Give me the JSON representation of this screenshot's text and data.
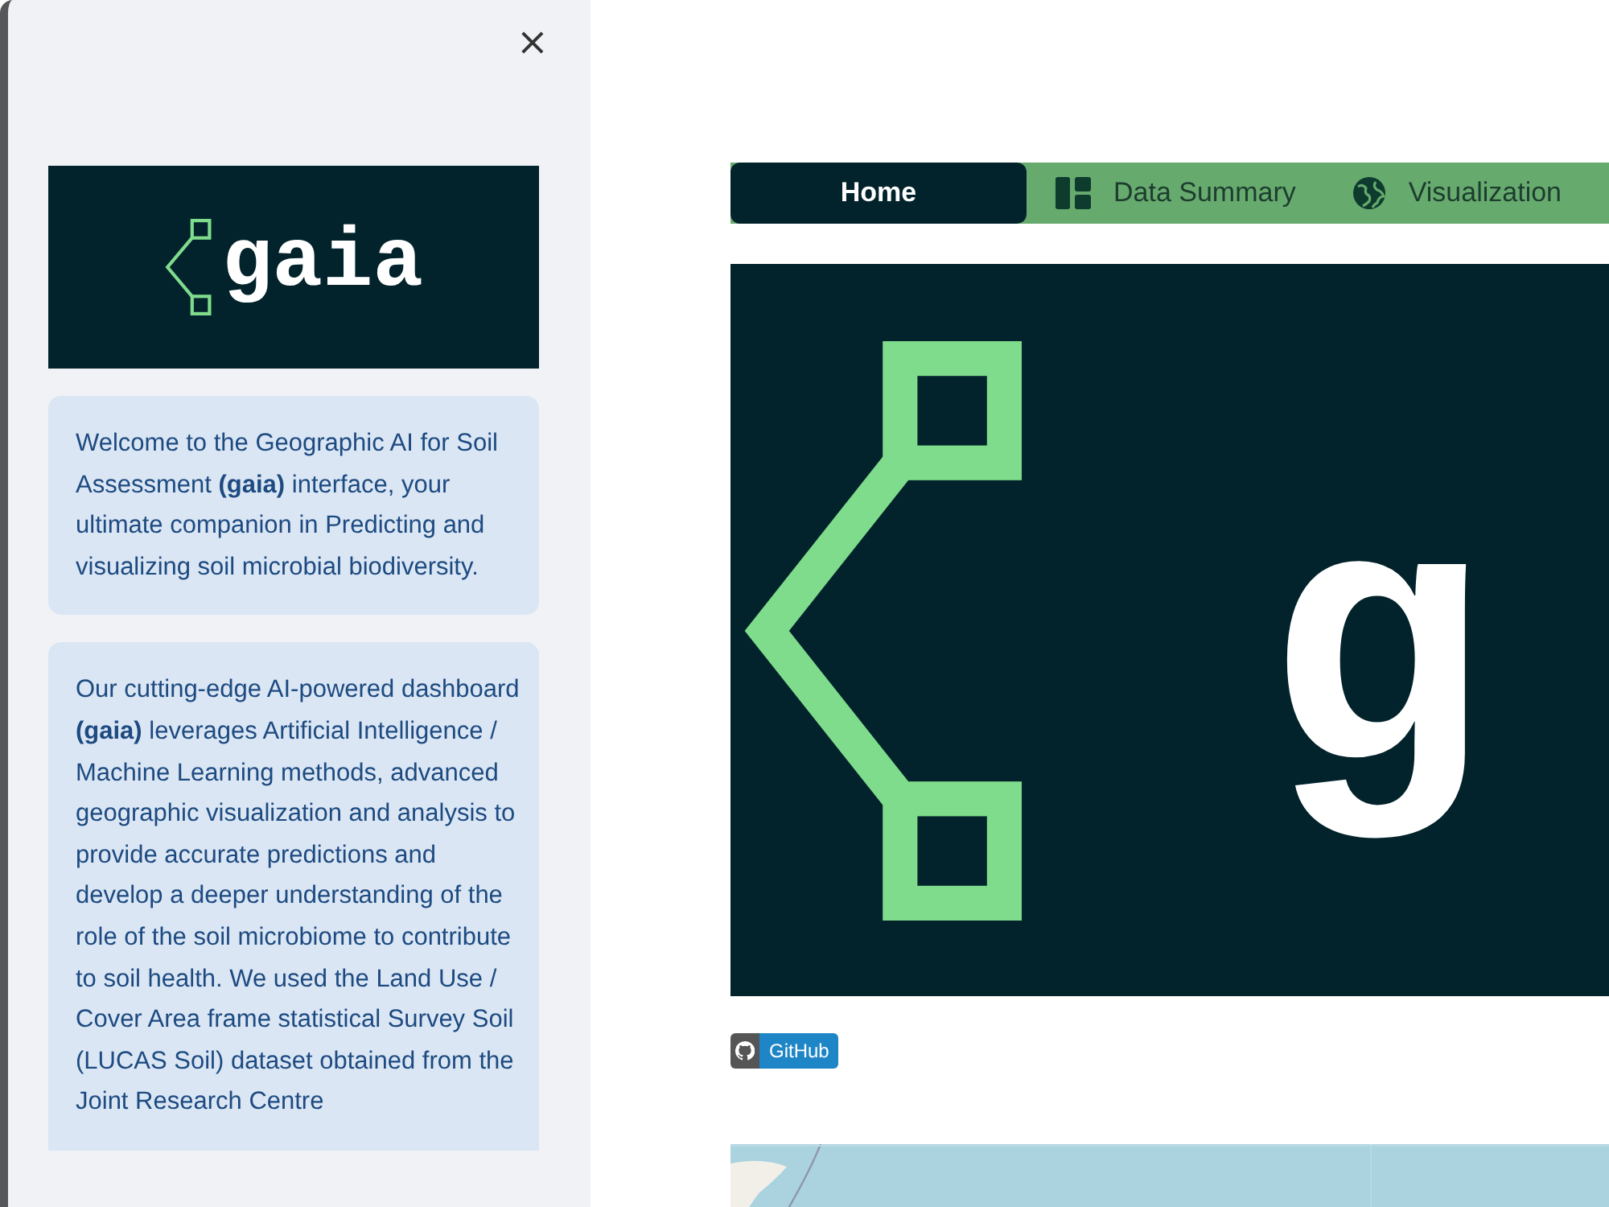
{
  "sidebar": {
    "close": "×",
    "logo": {
      "text": "gaia"
    },
    "info_boxes": [
      "Welcome to the Geographic AI for Soil Assessment **(gaia)** interface, your ultimate companion in Predicting and visualizing soil microbial biodiversity.",
      "Our cutting-edge AI-powered dashboard **(gaia)** leverages Artificial Intelligence / Machine Learning methods, advanced geographic visualization and analysis to provide accurate predictions and develop a deeper understanding of the role of the soil microbiome to contribute to soil health. We used the Land Use / Cover Area frame statistical Survey Soil (LUCAS Soil) dataset obtained from the Joint Research Centre"
    ]
  },
  "tabs": [
    {
      "label": "Home",
      "selected": true
    },
    {
      "label": "Data Summary",
      "selected": false
    },
    {
      "label": "Visualization",
      "selected": false
    }
  ],
  "banner": {
    "text": "g"
  },
  "badge": {
    "label": "GitHub"
  }
}
